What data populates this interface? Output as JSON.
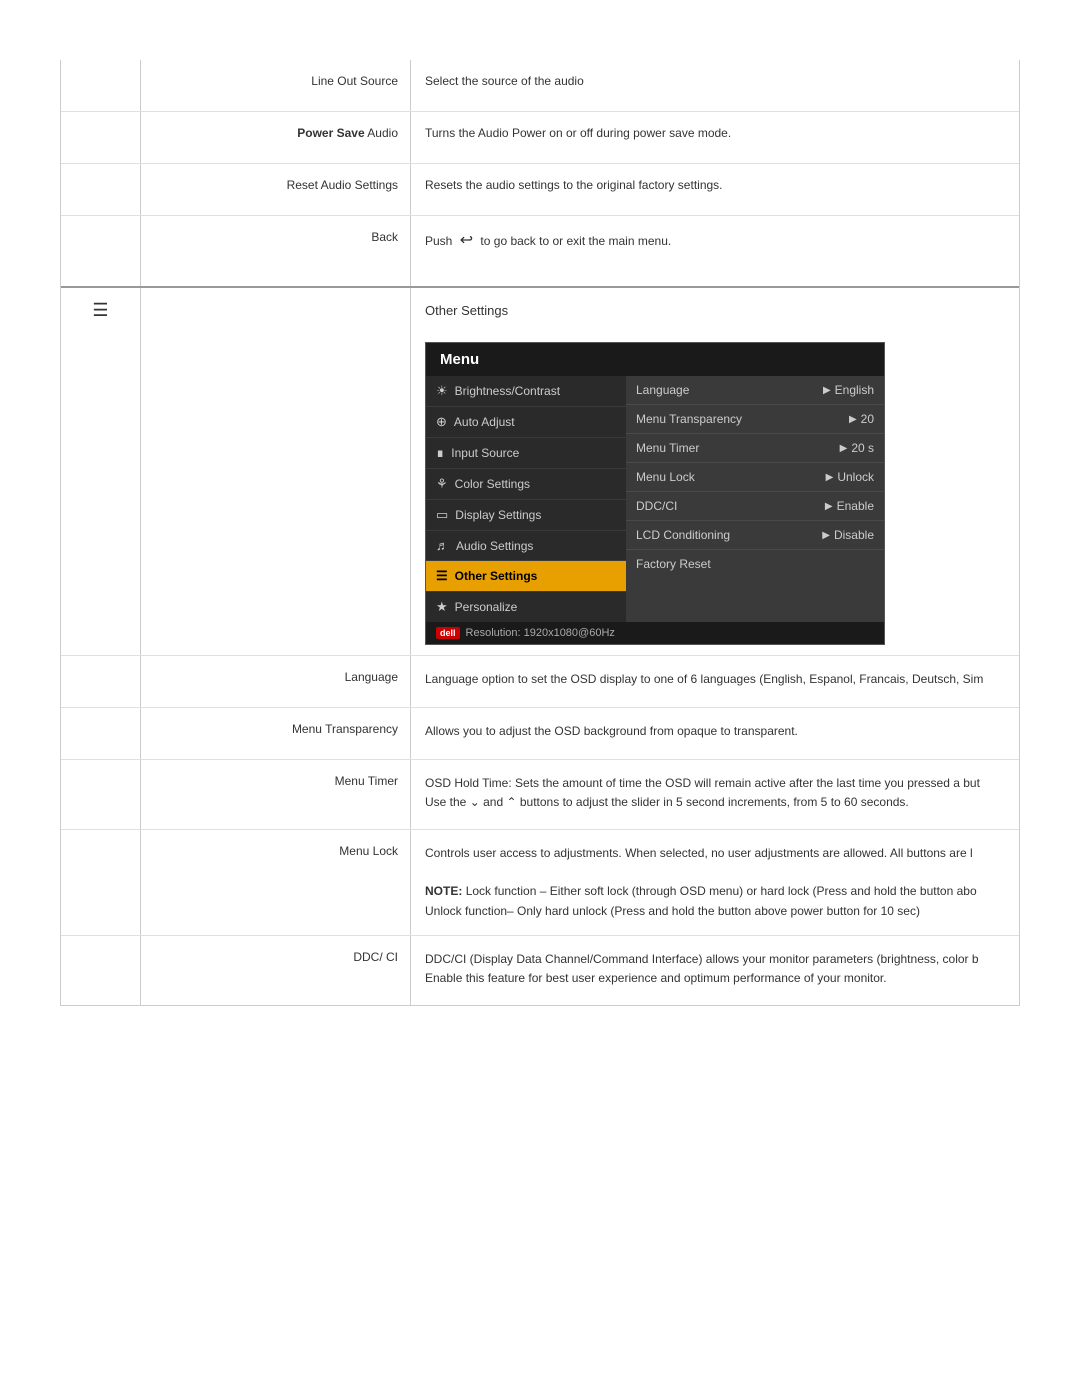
{
  "audio_section": {
    "rows": [
      {
        "label": "Line Out Source",
        "label_bold": false,
        "description": "Select the source of the audio"
      },
      {
        "label": "Power Save Audio",
        "label_bold": true,
        "bold_part": "Power Save",
        "plain_part": " Audio",
        "description": "Turns the Audio Power on or off during power save mode."
      },
      {
        "label": "Reset Audio Settings",
        "label_bold": false,
        "description": "Resets the audio settings to the original factory settings."
      },
      {
        "label": "Back",
        "label_bold": false,
        "description": "Push  ↩  to go back to or exit the main menu."
      }
    ]
  },
  "other_settings": {
    "section_title": "Other Settings",
    "menu": {
      "title": "Menu",
      "left_items": [
        {
          "icon": "☀",
          "label": "Brightness/Contrast",
          "active": false
        },
        {
          "icon": "⊕",
          "label": "Auto Adjust",
          "active": false
        },
        {
          "icon": "⊞",
          "label": "Input Source",
          "active": false
        },
        {
          "icon": "⚙",
          "label": "Color Settings",
          "active": false
        },
        {
          "icon": "▭",
          "label": "Display Settings",
          "active": false
        },
        {
          "icon": "♪",
          "label": "Audio Settings",
          "active": false
        },
        {
          "icon": "≡",
          "label": "Other Settings",
          "active": true
        },
        {
          "icon": "★",
          "label": "Personalize",
          "active": false
        }
      ],
      "right_items": [
        {
          "label": "Language",
          "value": "English"
        },
        {
          "label": "Menu Transparency",
          "value": "20"
        },
        {
          "label": "Menu Timer",
          "value": "20 s"
        },
        {
          "label": "Menu Lock",
          "value": "Unlock"
        },
        {
          "label": "DDC/CI",
          "value": "Enable"
        },
        {
          "label": "LCD Conditioning",
          "value": "Disable"
        },
        {
          "label": "Factory Reset",
          "value": ""
        }
      ],
      "footer_logo": "dell",
      "footer_text": "Resolution: 1920x1080@60Hz"
    },
    "desc_rows": [
      {
        "label": "Language",
        "content": "Language option to set the OSD display to one of 6 languages (English, Espanol, Francais, Deutsch, Sim"
      },
      {
        "label": "Menu Transparency",
        "content": "Allows you to adjust the OSD background from opaque to transparent."
      },
      {
        "label": "Menu Timer",
        "content": "OSD Hold Time: Sets the amount of time the OSD will remain active after the last time you pressed a but\nUse the ∨ and ∧ buttons to adjust the slider in 5 second increments, from 5 to 60 seconds."
      },
      {
        "label": "Menu Lock",
        "content_main": "Controls user access to adjustments. When selected, no user adjustments are allowed. All buttons are l",
        "content_note": "NOTE: Lock function – Either soft lock (through OSD menu) or hard lock (Press and hold the button abo\nUnlock function– Only hard unlock (Press and hold the button above power button for 10 sec)"
      },
      {
        "label": "DDC/ CI",
        "content": "DDC/CI (Display Data Channel/Command Interface) allows your monitor parameters (brightness, color b\nEnable this feature for best user experience and optimum performance of your monitor."
      }
    ]
  }
}
